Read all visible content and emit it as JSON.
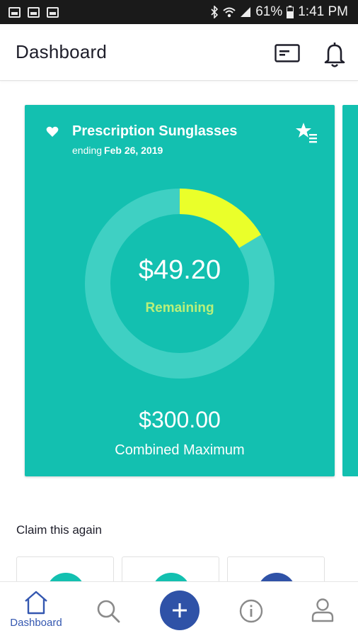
{
  "status_bar": {
    "battery": "61%",
    "time": "1:41 PM"
  },
  "header": {
    "title": "Dashboard"
  },
  "benefit_card": {
    "title": "Prescription Sunglasses",
    "ending_prefix": "ending",
    "ending_date": "Feb 26, 2019",
    "remaining_amount": "$49.20",
    "remaining_label": "Remaining",
    "maximum_amount": "$300.00",
    "maximum_label": "Combined Maximum",
    "used_fraction": 0.164,
    "colors": {
      "card": "#13c0b0",
      "ring_track": "#3fd0c3",
      "ring_progress": "#eaff2a",
      "remaining_label": "#b9f07a"
    }
  },
  "claim_again": {
    "title": "Claim this again",
    "item_colors": [
      "#13c0b0",
      "#13c0b0",
      "#2f52a7"
    ]
  },
  "bottom_nav": {
    "home_label": "Dashboard",
    "accent": "#3457b0"
  }
}
